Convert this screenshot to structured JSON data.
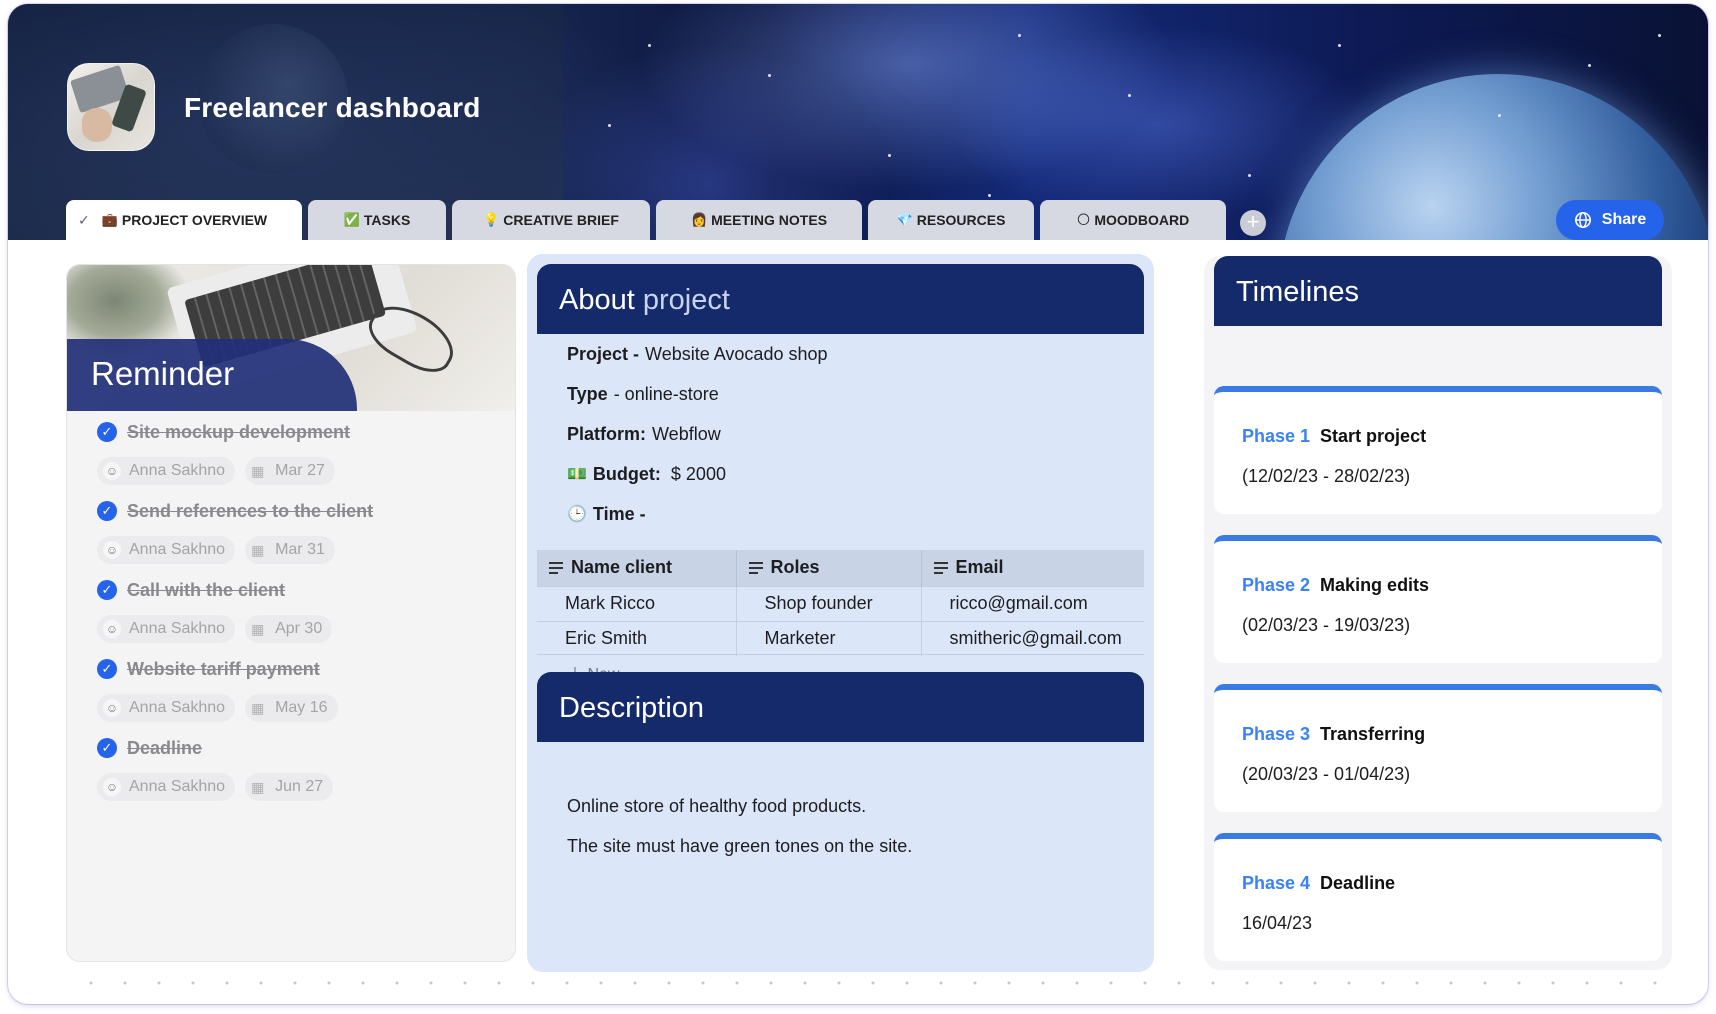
{
  "header": {
    "title": "Freelancer dashboard",
    "share_label": "Share"
  },
  "tabs": [
    {
      "label": "PROJECT OVERVIEW",
      "emoji": "💼"
    },
    {
      "label": "TASKS",
      "emoji": "✅"
    },
    {
      "label": "CREATIVE BRIEF",
      "emoji": "💡"
    },
    {
      "label": "MEETING NOTES",
      "emoji": "👩"
    },
    {
      "label": "RESOURCES",
      "emoji": "💎"
    },
    {
      "label": "MOODBOARD",
      "emoji": "🌕"
    }
  ],
  "reminder": {
    "title": "Reminder",
    "items": [
      {
        "title": "Site mockup development",
        "assignee": "Anna Sakhno",
        "date": "Mar 27",
        "done": true
      },
      {
        "title": "Send references to the client",
        "assignee": "Anna Sakhno",
        "date": "Mar 31",
        "done": true
      },
      {
        "title": "Call with the client",
        "assignee": "Anna Sakhno",
        "date": "Apr 30",
        "done": true
      },
      {
        "title": "Website tariff payment",
        "assignee": "Anna Sakhno",
        "date": "May 16",
        "done": true
      },
      {
        "title": "Deadline",
        "assignee": "Anna Sakhno",
        "date": "Jun 27",
        "done": true
      }
    ]
  },
  "about": {
    "title_main": "About",
    "title_light": "project",
    "fields": {
      "project_label": "Project -",
      "project_value": "Website Avocado shop",
      "type_label": "Type",
      "type_value": "- online-store",
      "platform_label": "Platform:",
      "platform_value": "Webflow",
      "budget_emoji": "💵",
      "budget_label": "Budget:",
      "budget_value": "$ 2000",
      "time_emoji": "🕒",
      "time_label": "Time -"
    },
    "table": {
      "headers": [
        "Name client",
        "Roles",
        "Email"
      ],
      "rows": [
        [
          "Mark Ricco",
          "Shop founder",
          "ricco@gmail.com"
        ],
        [
          "Eric Smith",
          "Marketer",
          "smitheric@gmail.com"
        ]
      ],
      "new_label": "New"
    }
  },
  "description": {
    "title": "Description",
    "lines": [
      "Online store of healthy food products.",
      "The site must have green tones on the site."
    ]
  },
  "timelines": {
    "title": "Timelines",
    "phases": [
      {
        "label": "Phase 1",
        "name": "Start project",
        "dates": "(12/02/23 - 28/02/23)"
      },
      {
        "label": "Phase 2",
        "name": "Making edits",
        "dates": "(02/03/23 - 19/03/23)"
      },
      {
        "label": "Phase 3",
        "name": "Transferring",
        "dates": "(20/03/23 - 01/04/23)"
      },
      {
        "label": "Phase 4",
        "name": "Deadline",
        "dates": "16/04/23"
      }
    ]
  },
  "colors": {
    "accent": "#2563eb",
    "section_header": "#142a6b",
    "phase_label": "#3b82f6",
    "about_bg": "#dbe6f8"
  }
}
